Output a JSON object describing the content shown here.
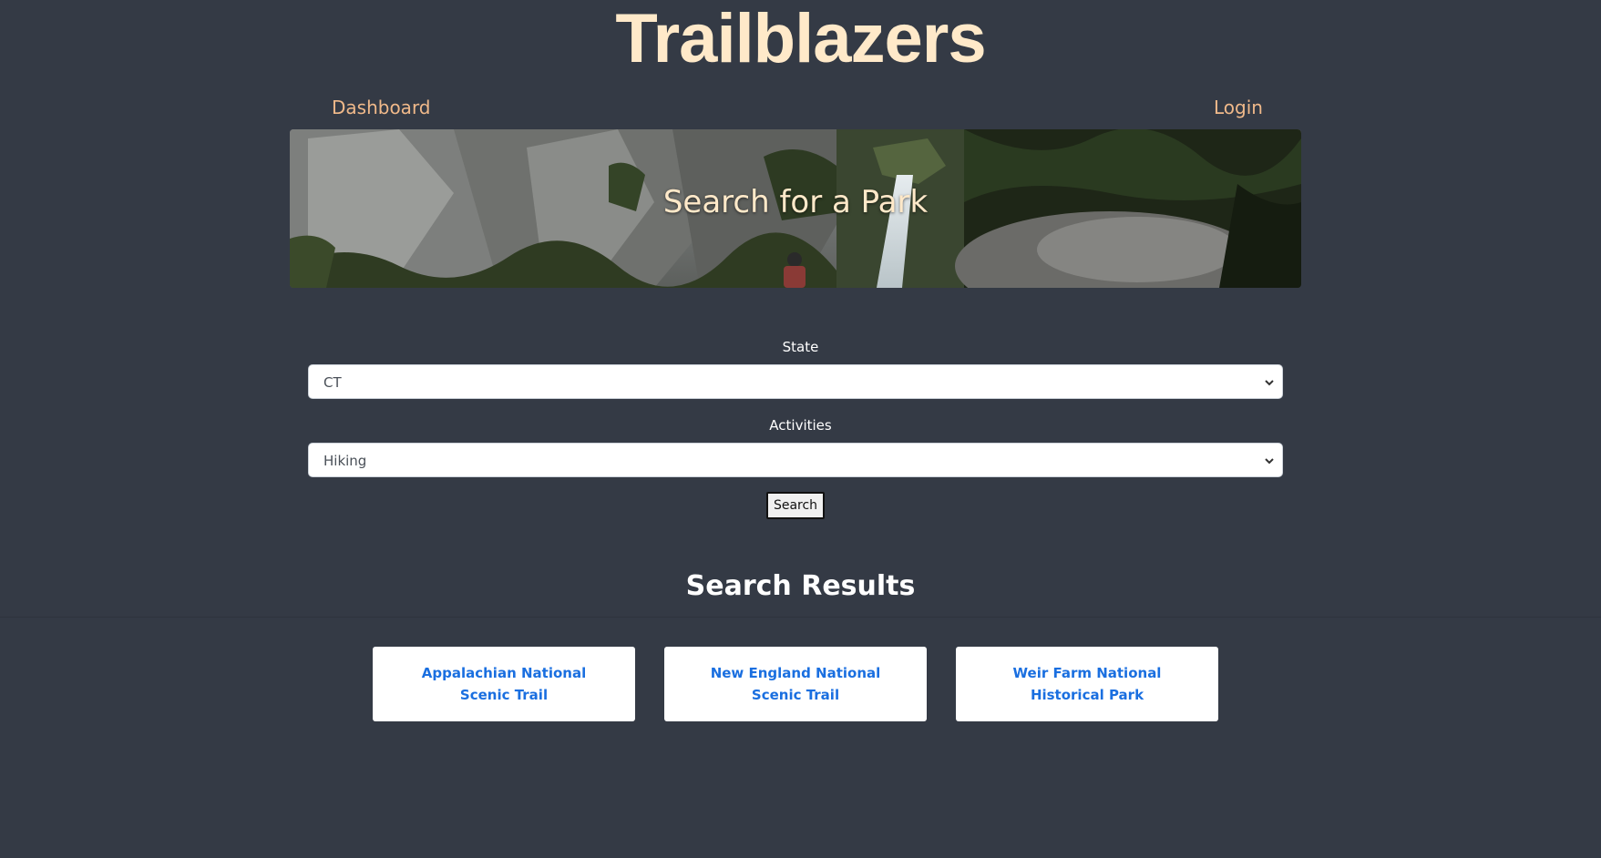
{
  "header": {
    "title": "Trailblazers"
  },
  "nav": {
    "dashboard_label": "Dashboard",
    "login_label": "Login"
  },
  "hero": {
    "title": "Search for a Park"
  },
  "form": {
    "state_label": "State",
    "state_value": "CT",
    "activities_label": "Activities",
    "activities_value": "Hiking",
    "search_button_label": "Search"
  },
  "results": {
    "heading": "Search Results",
    "items": [
      {
        "name": "Appalachian National Scenic Trail"
      },
      {
        "name": "New England National Scenic Trail"
      },
      {
        "name": "Weir Farm National Historical Park"
      }
    ]
  },
  "colors": {
    "background": "#343a45",
    "title": "#ffe9c9",
    "nav_link": "#f0b98a",
    "result_link": "#1a6fe0"
  }
}
